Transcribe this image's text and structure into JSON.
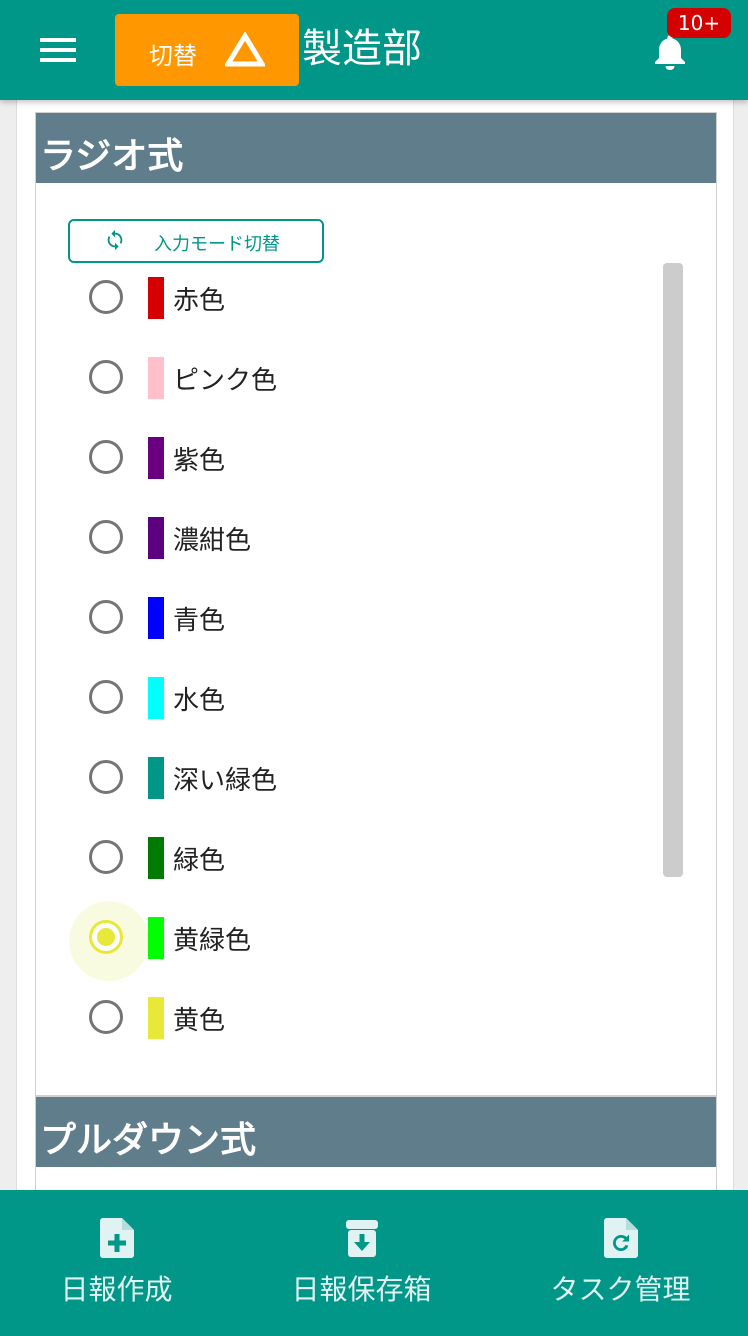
{
  "header": {
    "switch_label": "切替",
    "title": "製造部",
    "notification_count": "10+"
  },
  "radio_section": {
    "title": "ラジオ式",
    "mode_button_label": "入力モード切替",
    "selected_index": 8,
    "options": [
      {
        "label": "赤色",
        "color": "#d50000"
      },
      {
        "label": "ピンク色",
        "color": "#ffc0cb"
      },
      {
        "label": "紫色",
        "color": "#6a0080"
      },
      {
        "label": "濃紺色",
        "color": "#5c0080"
      },
      {
        "label": "青色",
        "color": "#0000ff"
      },
      {
        "label": "水色",
        "color": "#00ffff"
      },
      {
        "label": "深い緑色",
        "color": "#009688"
      },
      {
        "label": "緑色",
        "color": "#007a00"
      },
      {
        "label": "黄緑色",
        "color": "#00ff00"
      },
      {
        "label": "黄色",
        "color": "#e8e838"
      }
    ]
  },
  "pulldown_section": {
    "title": "プルダウン式"
  },
  "bottom_nav": {
    "items": [
      {
        "label": "日報作成",
        "icon": "file-plus-icon"
      },
      {
        "label": "日報保存箱",
        "icon": "archive-download-icon"
      },
      {
        "label": "タスク管理",
        "icon": "file-refresh-icon"
      }
    ]
  },
  "colors": {
    "primary": "#009688",
    "accent": "#ff9800",
    "section_header": "#607d8b",
    "badge": "#d50000"
  }
}
